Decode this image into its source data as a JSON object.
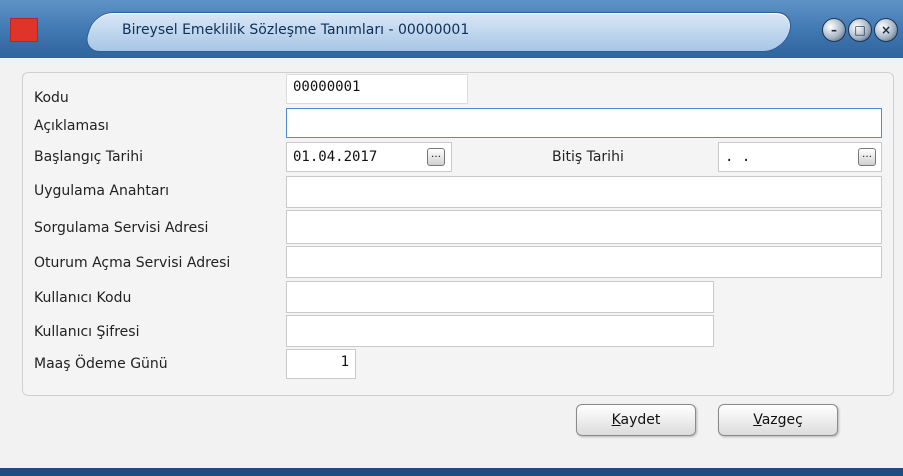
{
  "window": {
    "title": "Bireysel Emeklilik Sözleşme Tanımları - 00000001"
  },
  "form": {
    "kodu_label": "Kodu",
    "kodu_value": "00000001",
    "aciklama_label": "Açıklaması",
    "aciklama_value": "",
    "baslangic_label": "Başlangıç Tarihi",
    "baslangic_value": "01.04.2017",
    "bitis_label": "Bitiş Tarihi",
    "bitis_value": ".  .",
    "uygulama_label": "Uygulama Anahtarı",
    "uygulama_value": "",
    "sorgulama_label": "Sorgulama Servisi Adresi",
    "sorgulama_value": "",
    "oturum_label": "Oturum Açma Servisi Adresi",
    "oturum_value": "",
    "kullanici_kodu_label": "Kullanıcı Kodu",
    "kullanici_kodu_value": "",
    "kullanici_sifre_label": "Kullanıcı Şifresi",
    "kullanici_sifre_value": "",
    "maas_label": "Maaş Ödeme Günü",
    "maas_value": "1",
    "lookup_glyph": "…"
  },
  "buttons": {
    "save_first": "K",
    "save_rest": "aydet",
    "cancel_first": "V",
    "cancel_rest": "azgeç"
  },
  "colors": {
    "titlebar": "#3f77b1",
    "app_icon": "#e0342a",
    "active_field_border": "#4b8dd6"
  }
}
